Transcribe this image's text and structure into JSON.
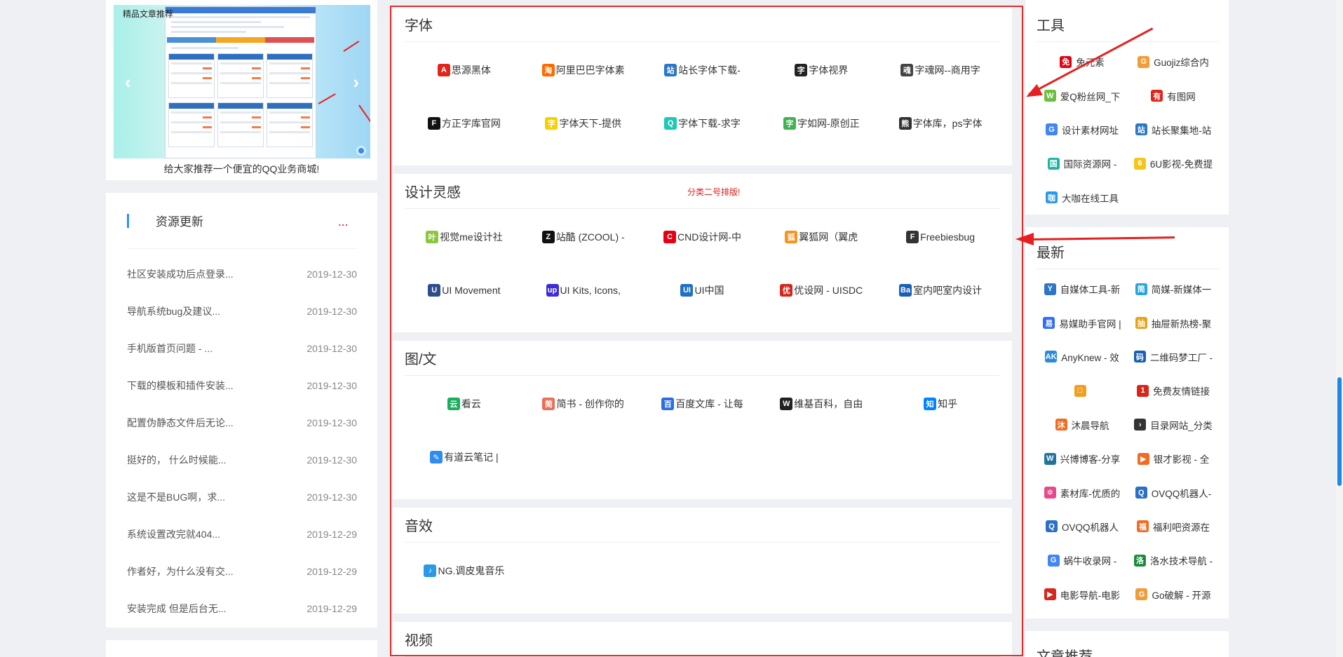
{
  "carousel": {
    "tag": "精品文章推荐",
    "caption": "给大家推荐一个便宜的QQ业务商城!",
    "prev": "‹",
    "next": "›"
  },
  "updates": {
    "title": "资源更新",
    "more": "...",
    "items": [
      {
        "text": "社区安装成功后点登录...",
        "date": "2019-12-30"
      },
      {
        "text": "导航系统bug及建议...",
        "date": "2019-12-30"
      },
      {
        "text": "手机版首页问题 - ...",
        "date": "2019-12-30"
      },
      {
        "text": "下载的模板和插件安装...",
        "date": "2019-12-30"
      },
      {
        "text": "配置伪静态文件后无论...",
        "date": "2019-12-30"
      },
      {
        "text": "挺好的， 什么时候能...",
        "date": "2019-12-30"
      },
      {
        "text": "这是不是BUG啊，求...",
        "date": "2019-12-30"
      },
      {
        "text": "系统设置改完就404...",
        "date": "2019-12-29"
      },
      {
        "text": "作者好，为什么没有交...",
        "date": "2019-12-29"
      },
      {
        "text": "安装完成 但是后台无...",
        "date": "2019-12-29"
      }
    ]
  },
  "sections": [
    {
      "title": "字体",
      "note": "",
      "links": [
        {
          "label": "思源黑体",
          "icon": "adobe-icon",
          "color": "#e1251b",
          "glyph": "A"
        },
        {
          "label": "阿里巴巴字体素",
          "icon": "taobao-icon",
          "color": "#ff6a00",
          "glyph": "淘"
        },
        {
          "label": "站长字体下载-",
          "icon": "chinaz-icon",
          "color": "#2b76c9",
          "glyph": "站"
        },
        {
          "label": "字体视界",
          "icon": "zitishijie-icon",
          "color": "#222222",
          "glyph": "字"
        },
        {
          "label": "字魂网--商用字",
          "icon": "zihun-icon",
          "color": "#444444",
          "glyph": "魂"
        },
        {
          "label": "方正字库官网",
          "icon": "founder-icon",
          "color": "#111111",
          "glyph": "F"
        },
        {
          "label": "字体天下-提供",
          "icon": "fonts-world-icon",
          "color": "#f5d100",
          "glyph": "字"
        },
        {
          "label": "字体下载-求字",
          "icon": "qiuziti-icon",
          "color": "#1dc8b4",
          "glyph": "Q"
        },
        {
          "label": "字如网-原创正",
          "icon": "ziru-icon",
          "color": "#3fb34f",
          "glyph": "字"
        },
        {
          "label": "字体库，ps字体",
          "icon": "panda-icon",
          "color": "#333333",
          "glyph": "熊"
        }
      ]
    },
    {
      "title": "设计灵感",
      "note": "分类二号排版!",
      "links": [
        {
          "label": "视觉me设计社",
          "icon": "leaf-icon",
          "color": "#8cc63f",
          "glyph": "叶"
        },
        {
          "label": "站酷 (ZCOOL) -",
          "icon": "zcool-icon",
          "color": "#111111",
          "glyph": "Z"
        },
        {
          "label": "CND设计网-中",
          "icon": "cnd-icon",
          "color": "#e60012",
          "glyph": "C"
        },
        {
          "label": "翼狐网（翼虎",
          "icon": "yiihuu-icon",
          "color": "#f7941d",
          "glyph": "狐"
        },
        {
          "label": "Freebiesbug",
          "icon": "freebiesbug-icon",
          "color": "#333333",
          "glyph": "F"
        },
        {
          "label": "UI Movement",
          "icon": "uimovement-icon",
          "color": "#2d4b8e",
          "glyph": "U"
        },
        {
          "label": "UI Kits, Icons,",
          "icon": "uplabs-icon",
          "color": "#3d2bd9",
          "glyph": "up"
        },
        {
          "label": "UI中国",
          "icon": "uichina-icon",
          "color": "#1f6fc5",
          "glyph": "UI"
        },
        {
          "label": "优设网 - UISDC",
          "icon": "uisdc-icon",
          "color": "#d7261b",
          "glyph": "优"
        },
        {
          "label": "室内吧室内设计",
          "icon": "shineiba-icon",
          "color": "#1a5fb4",
          "glyph": "Ba"
        }
      ]
    },
    {
      "title": "图/文",
      "note": "",
      "links": [
        {
          "label": "看云",
          "icon": "kancloud-icon",
          "color": "#1aaf5d",
          "glyph": "云"
        },
        {
          "label": "简书 - 创作你的",
          "icon": "jianshu-icon",
          "color": "#ea6f5a",
          "glyph": "简"
        },
        {
          "label": "百度文库 - 让每",
          "icon": "baidu-wenku-icon",
          "color": "#2d6ee0",
          "glyph": "百"
        },
        {
          "label": "维基百科，自由",
          "icon": "wikipedia-icon",
          "color": "#222222",
          "glyph": "W"
        },
        {
          "label": "知乎",
          "icon": "zhihu-icon",
          "color": "#0084ff",
          "glyph": "知"
        },
        {
          "label": "有道云笔记 |",
          "icon": "youdao-note-icon",
          "color": "#2f8cf0",
          "glyph": "✎"
        }
      ]
    },
    {
      "title": "音效",
      "note": "",
      "links": [
        {
          "label": "NG.调皮鬼音乐",
          "icon": "ng-music-icon",
          "color": "#2b9ae6",
          "glyph": "♪"
        }
      ]
    },
    {
      "title": "视频",
      "note": "",
      "links": []
    }
  ],
  "right": [
    {
      "title": "工具",
      "links": [
        {
          "label": "免元素",
          "icon": "mianyuansu-icon",
          "color": "#e60012",
          "glyph": "免"
        },
        {
          "label": "Guojiz综合内",
          "icon": "guojiz-icon",
          "color": "#f29b38",
          "glyph": "G"
        },
        {
          "label": "爱Q粉丝网_下",
          "icon": "aiq-icon",
          "color": "#6cbf3f",
          "glyph": "W"
        },
        {
          "label": "有图网",
          "icon": "youtu-icon",
          "color": "#e1251b",
          "glyph": "有"
        },
        {
          "label": "设计素材网址",
          "icon": "google-icon",
          "color": "#4285f4",
          "glyph": "G"
        },
        {
          "label": "站长聚集地-站",
          "icon": "zhanzhang-icon",
          "color": "#2b76c9",
          "glyph": "站"
        },
        {
          "label": "国际资源网 -",
          "icon": "guoji-icon",
          "color": "#1fb5a0",
          "glyph": "国"
        },
        {
          "label": "6U影视-免费提",
          "icon": "6u-icon",
          "color": "#f5c518",
          "glyph": "6"
        },
        {
          "label": "大咖在线工具",
          "icon": "daka-icon",
          "color": "#2b9ae6",
          "glyph": "咖"
        }
      ]
    },
    {
      "title": "最新",
      "links": [
        {
          "label": "自媒体工具-新",
          "icon": "zimeiti-icon",
          "color": "#2b76c9",
          "glyph": "Y"
        },
        {
          "label": "简媒-新媒体一",
          "icon": "jianmei-icon",
          "color": "#24a3e3",
          "glyph": "简"
        },
        {
          "label": "易媒助手官网 |",
          "icon": "yimei-icon",
          "color": "#2f6ff5",
          "glyph": "易"
        },
        {
          "label": "抽屉新热榜-聚",
          "icon": "chouti-icon",
          "color": "#e8a417",
          "glyph": "抽"
        },
        {
          "label": "AnyKnew - 效",
          "icon": "anyknew-icon",
          "color": "#2a8bd8",
          "glyph": "AK"
        },
        {
          "label": "二维码梦工厂 -",
          "icon": "qrcode-icon",
          "color": "#1a5fb4",
          "glyph": "码"
        },
        {
          "label": "",
          "icon": "blank-icon",
          "color": "#f0a020",
          "glyph": "□"
        },
        {
          "label": "免费友情链接",
          "icon": "youqing-icon",
          "color": "#d7261b",
          "glyph": "1"
        },
        {
          "label": "沐晨导航",
          "icon": "muchen-icon",
          "color": "#f26b21",
          "glyph": "沐"
        },
        {
          "label": "目录网站_分类",
          "icon": "chevron-right-icon",
          "color": "#333333",
          "glyph": "›"
        },
        {
          "label": "兴博博客-分享",
          "icon": "wordpress-icon",
          "color": "#21759b",
          "glyph": "W"
        },
        {
          "label": "银才影视 - 全",
          "icon": "yincai-icon",
          "color": "#f26b21",
          "glyph": "▶"
        },
        {
          "label": "素材库-优质的",
          "icon": "sucai-icon",
          "color": "#e64a8c",
          "glyph": "✲"
        },
        {
          "label": "OVQQ机器人-",
          "icon": "ovqq-icon",
          "color": "#2a6fc9",
          "glyph": "Q"
        },
        {
          "label": "OVQQ机器人",
          "icon": "ovqq2-icon",
          "color": "#2a6fc9",
          "glyph": "Q"
        },
        {
          "label": "福利吧资源在",
          "icon": "fuli-icon",
          "color": "#f26b21",
          "glyph": "福"
        },
        {
          "label": "蜗牛收录网 -",
          "icon": "google2-icon",
          "color": "#4285f4",
          "glyph": "G"
        },
        {
          "label": "洛水技术导航 -",
          "icon": "luoshui-icon",
          "color": "#1b8a3e",
          "glyph": "洛"
        },
        {
          "label": "电影导航-电影",
          "icon": "movie-icon",
          "color": "#d7261b",
          "glyph": "▶"
        },
        {
          "label": "Go破解 - 开源",
          "icon": "go-icon",
          "color": "#f29b38",
          "glyph": "G"
        }
      ]
    },
    {
      "title": "文章推荐",
      "links": []
    }
  ]
}
